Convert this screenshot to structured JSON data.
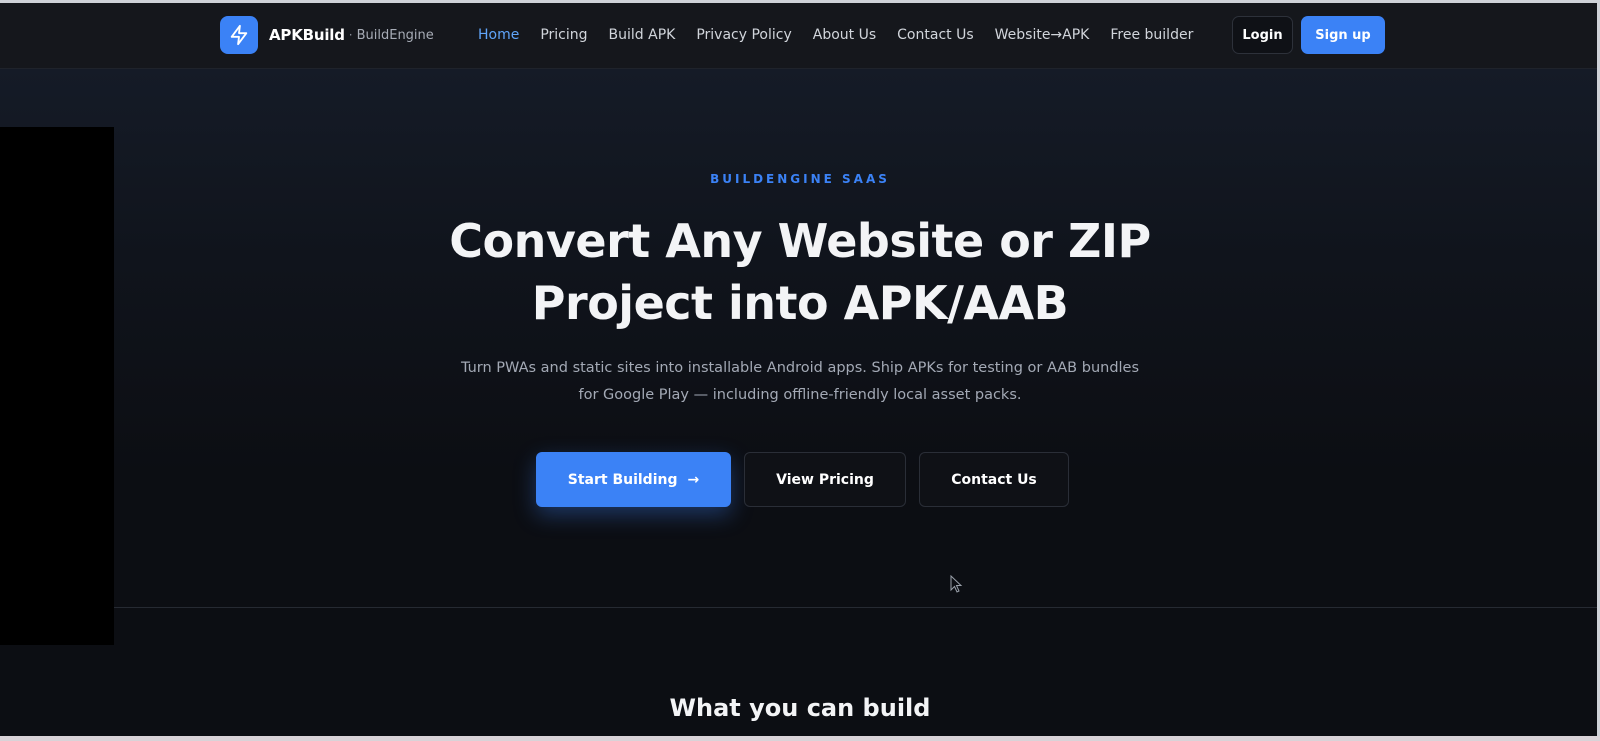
{
  "header": {
    "brand": {
      "name": "APKBuild",
      "separator": "·",
      "subtitle": "BuildEngine",
      "logo_icon": "lightning-bolt-icon"
    },
    "nav": [
      {
        "label": "Home",
        "active": true
      },
      {
        "label": "Pricing",
        "active": false
      },
      {
        "label": "Build APK",
        "active": false
      },
      {
        "label": "Privacy Policy",
        "active": false
      },
      {
        "label": "About Us",
        "active": false
      },
      {
        "label": "Contact Us",
        "active": false
      },
      {
        "label": "Website→APK",
        "active": false
      },
      {
        "label": "Free builder",
        "active": false
      }
    ],
    "login_label": "Login",
    "signup_label": "Sign up"
  },
  "hero": {
    "eyebrow": "BUILDENGINE SAAS",
    "title_line1": "Convert Any Website or ZIP",
    "title_line2": "Project into APK/AAB",
    "subtitle_line1": "Turn PWAs and static sites into installable Android apps. Ship APKs for testing or AAB bundles",
    "subtitle_line2": "for Google Play — including offline-friendly local asset packs.",
    "primary_cta": "Start Building",
    "primary_cta_icon": "arrow-right-icon",
    "pricing_cta": "View Pricing",
    "contact_cta": "Contact Us"
  },
  "next_section": {
    "title": "What you can build"
  },
  "colors": {
    "accent": "#3b82f6",
    "background": "#0c0e13",
    "navbar": "#15171c",
    "nav_active": "#60a5fa"
  }
}
